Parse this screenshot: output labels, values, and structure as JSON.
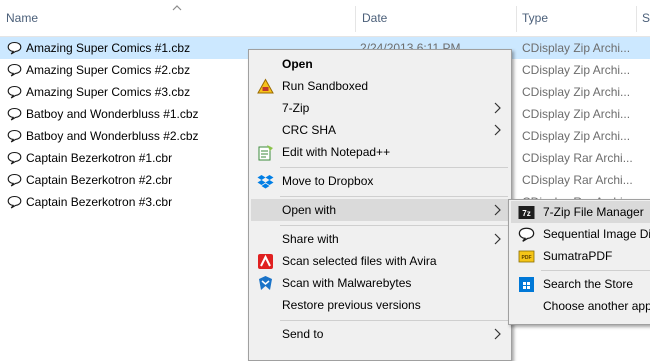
{
  "columns": {
    "name": "Name",
    "date": "Date",
    "type": "Type",
    "size": "S"
  },
  "files": [
    {
      "name": "Amazing Super Comics #1.cbz",
      "date": "2/24/2013 6:11 PM",
      "type": "CDisplay Zip Archi..."
    },
    {
      "name": "Amazing Super Comics #2.cbz",
      "date": "",
      "type": "CDisplay Zip Archi..."
    },
    {
      "name": "Amazing Super Comics #3.cbz",
      "date": "",
      "type": "CDisplay Zip Archi..."
    },
    {
      "name": "Batboy and Wonderbluss #1.cbz",
      "date": "",
      "type": "CDisplay Zip Archi..."
    },
    {
      "name": "Batboy and Wonderbluss #2.cbz",
      "date": "",
      "type": "CDisplay Zip Archi..."
    },
    {
      "name": "Captain Bezerkotron #1.cbr",
      "date": "",
      "type": "CDisplay Rar Archi..."
    },
    {
      "name": "Captain Bezerkotron #2.cbr",
      "date": "",
      "type": "CDisplay Rar Archi..."
    },
    {
      "name": "Captain Bezerkotron #3.cbr",
      "date": "",
      "type": "CDisplay Rar Archi..."
    }
  ],
  "context_menu": {
    "open": "Open",
    "run_sandboxed": "Run Sandboxed",
    "seven_zip": "7-Zip",
    "crc_sha": "CRC SHA",
    "edit_notepad": "Edit with Notepad++",
    "move_dropbox": "Move to Dropbox",
    "open_with": "Open with",
    "share_with": "Share with",
    "scan_avira": "Scan selected files with Avira",
    "scan_malwarebytes": "Scan with Malwarebytes",
    "restore_versions": "Restore previous versions",
    "send_to": "Send to"
  },
  "open_with_menu": {
    "seven_zip_fm": "7-Zip File Manager",
    "sequential": "Sequential Image Dis",
    "sumatra": "SumatraPDF",
    "search_store": "Search the Store",
    "choose_app": "Choose another app"
  },
  "colors": {
    "selection": "#cce8ff",
    "menu_bg": "#f0f0f0",
    "menu_highlight": "#dadada",
    "header_text": "#4c607a"
  }
}
